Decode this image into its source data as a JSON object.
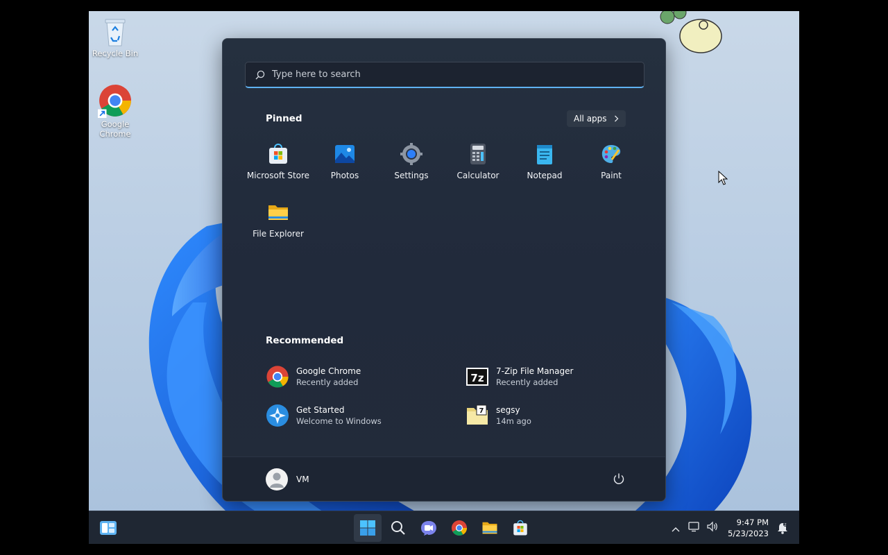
{
  "desktop": {
    "icons": [
      {
        "label": "Recycle Bin",
        "icon": "recycle-bin-icon"
      },
      {
        "label": "Google Chrome",
        "icon": "chrome-icon"
      }
    ]
  },
  "start_menu": {
    "search_placeholder": "Type here to search",
    "pinned_title": "Pinned",
    "all_apps_label": "All apps",
    "pinned": [
      {
        "label": "Microsoft Store",
        "icon": "microsoft-store-icon"
      },
      {
        "label": "Photos",
        "icon": "photos-icon"
      },
      {
        "label": "Settings",
        "icon": "settings-icon"
      },
      {
        "label": "Calculator",
        "icon": "calculator-icon"
      },
      {
        "label": "Notepad",
        "icon": "notepad-icon"
      },
      {
        "label": "Paint",
        "icon": "paint-icon"
      },
      {
        "label": "File Explorer",
        "icon": "file-explorer-icon"
      }
    ],
    "recommended_title": "Recommended",
    "recommended": [
      {
        "title": "Google Chrome",
        "subtitle": "Recently added",
        "icon": "chrome-icon"
      },
      {
        "title": "7-Zip File Manager",
        "subtitle": "Recently added",
        "icon": "7zip-icon"
      },
      {
        "title": "Get Started",
        "subtitle": "Welcome to Windows",
        "icon": "get-started-icon"
      },
      {
        "title": "segsy",
        "subtitle": "14m ago",
        "icon": "archive-file-icon"
      }
    ],
    "user_name": "VM"
  },
  "taskbar": {
    "apps": [
      "widgets-icon",
      "start-icon",
      "search-icon",
      "teams-chat-icon",
      "chrome-icon",
      "file-explorer-icon",
      "microsoft-store-icon"
    ],
    "time": "9:47 PM",
    "date": "5/23/2023"
  },
  "colors": {
    "accent": "#5fb2f2",
    "start_bg": "#222b3a",
    "taskbar_bg": "#1f2733",
    "wallpaper_blue": "#1565e0"
  }
}
